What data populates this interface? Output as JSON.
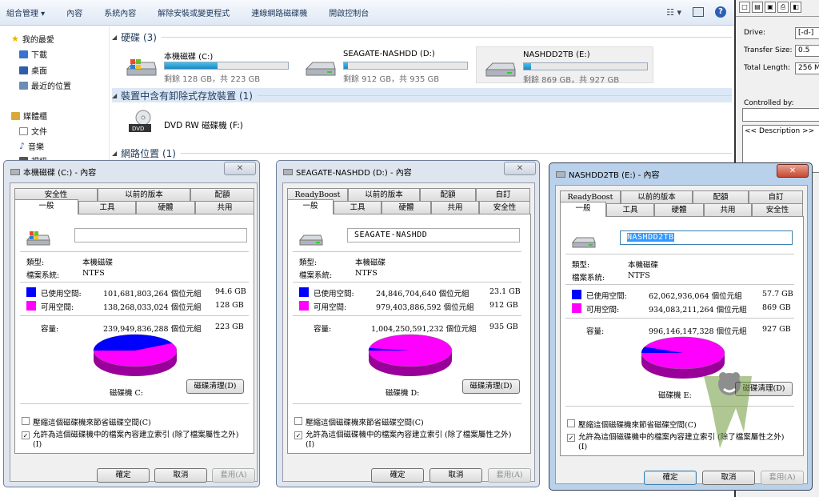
{
  "toolbar": {
    "items": [
      "組合管理 ▾",
      "內容",
      "系統內容",
      "解除安裝或變更程式",
      "連線網路磁碟機",
      "開啟控制台"
    ]
  },
  "nav": {
    "favorites": "我的最愛",
    "items": [
      "下載",
      "桌面",
      "最近的位置"
    ],
    "library": "媒體櫃",
    "lib_items": [
      "文件",
      "音樂",
      "視訊"
    ]
  },
  "sections": {
    "hdd": "硬碟 (3)",
    "removable": "裝置中含有卸除式存放裝置 (1)",
    "network": "網路位置 (1)"
  },
  "drives": [
    {
      "name": "本機磁碟 (C:)",
      "free": "剩餘 128 GB，共 223 GB",
      "used_fraction": 0.43
    },
    {
      "name": "SEAGATE-NASHDD (D:)",
      "free": "剩餘 912 GB，共 935 GB",
      "used_fraction": 0.03
    },
    {
      "name": "NASHDD2TB (E:)",
      "free": "剩餘 869 GB，共 927 GB",
      "used_fraction": 0.06
    }
  ],
  "dvd": {
    "name": "DVD RW 磁碟機 (F:)",
    "label": "DVD"
  },
  "right_panel": {
    "drive_label": "Drive:",
    "drive_value": "[-d-]",
    "transfer_label": "Transfer Size:",
    "transfer_value": "0.5",
    "total_label": "Total Length:",
    "total_value": "256 M",
    "controlled_label": "Controlled by:",
    "desc": "<< Description >>"
  },
  "dialogs": [
    {
      "title": "本機磁碟 (C:) - 內容",
      "tabs_top": [
        "安全性",
        "以前的版本",
        "配額"
      ],
      "tabs_bottom": [
        "一般",
        "工具",
        "硬體",
        "共用"
      ],
      "name_value": "",
      "type_label": "類型:",
      "type_value": "本機磁碟",
      "fs_label": "檔案系統:",
      "fs_value": "NTFS",
      "used_label": "已使用空間:",
      "used_bytes": "101,681,803,264 個位元組",
      "used_gb": "94.6 GB",
      "free_label": "可用空間:",
      "free_bytes": "138,268,033,024 個位元組",
      "free_gb": "128 GB",
      "cap_label": "容量:",
      "cap_bytes": "239,949,836,288 個位元組",
      "cap_gb": "223 GB",
      "used_fraction": 0.424,
      "drive_caption": "磁碟機 C:",
      "cleanup": "磁碟清理(D)",
      "compress": "壓縮這個磁碟機來節省磁碟空間(C)",
      "index": "允許為這個磁碟機中的檔案內容建立索引 (除了檔案屬性之外)(I)",
      "ok": "確定",
      "cancel": "取消",
      "apply": "套用(A)"
    },
    {
      "title": "SEAGATE-NASHDD (D:) - 內容",
      "tabs_top": [
        "ReadyBoost",
        "以前的版本",
        "配額",
        "自訂"
      ],
      "tabs_bottom": [
        "一般",
        "工具",
        "硬體",
        "共用",
        "安全性"
      ],
      "name_value": "SEAGATE-NASHDD",
      "type_label": "類型:",
      "type_value": "本機磁碟",
      "fs_label": "檔案系統:",
      "fs_value": "NTFS",
      "used_label": "已使用空間:",
      "used_bytes": "24,846,704,640 個位元組",
      "used_gb": "23.1 GB",
      "free_label": "可用空間:",
      "free_bytes": "979,403,886,592 個位元組",
      "free_gb": "912 GB",
      "cap_label": "容量:",
      "cap_bytes": "1,004,250,591,232 個位元組",
      "cap_gb": "935 GB",
      "used_fraction": 0.025,
      "drive_caption": "磁碟機 D:",
      "cleanup": "磁碟清理(D)",
      "compress": "壓縮這個磁碟機來節省磁碟空間(C)",
      "index": "允許為這個磁碟機中的檔案內容建立索引 (除了檔案屬性之外)(I)",
      "ok": "確定",
      "cancel": "取消",
      "apply": "套用(A)"
    },
    {
      "title": "NASHDD2TB (E:) - 內容",
      "tabs_top": [
        "ReadyBoost",
        "以前的版本",
        "配額",
        "自訂"
      ],
      "tabs_bottom": [
        "一般",
        "工具",
        "硬體",
        "共用",
        "安全性"
      ],
      "name_value": "NASHDD2TB",
      "type_label": "類型:",
      "type_value": "本機磁碟",
      "fs_label": "檔案系統:",
      "fs_value": "NTFS",
      "used_label": "已使用空間:",
      "used_bytes": "62,062,936,064 個位元組",
      "used_gb": "57.7 GB",
      "free_label": "可用空間:",
      "free_bytes": "934,083,211,264 個位元組",
      "free_gb": "869 GB",
      "cap_label": "容量:",
      "cap_bytes": "996,146,147,328 個位元組",
      "cap_gb": "927 GB",
      "used_fraction": 0.062,
      "drive_caption": "磁碟機 E:",
      "cleanup": "磁碟清理(D)",
      "compress": "壓縮這個磁碟機來節省磁碟空間(C)",
      "index": "允許為這個磁碟機中的檔案內容建立索引 (除了檔案屬性之外)(I)",
      "ok": "確定",
      "cancel": "取消",
      "apply": "套用(A)"
    }
  ],
  "colors": {
    "used": "#0000ff",
    "free": "#ff00ff",
    "bar": "#1b86c4"
  }
}
